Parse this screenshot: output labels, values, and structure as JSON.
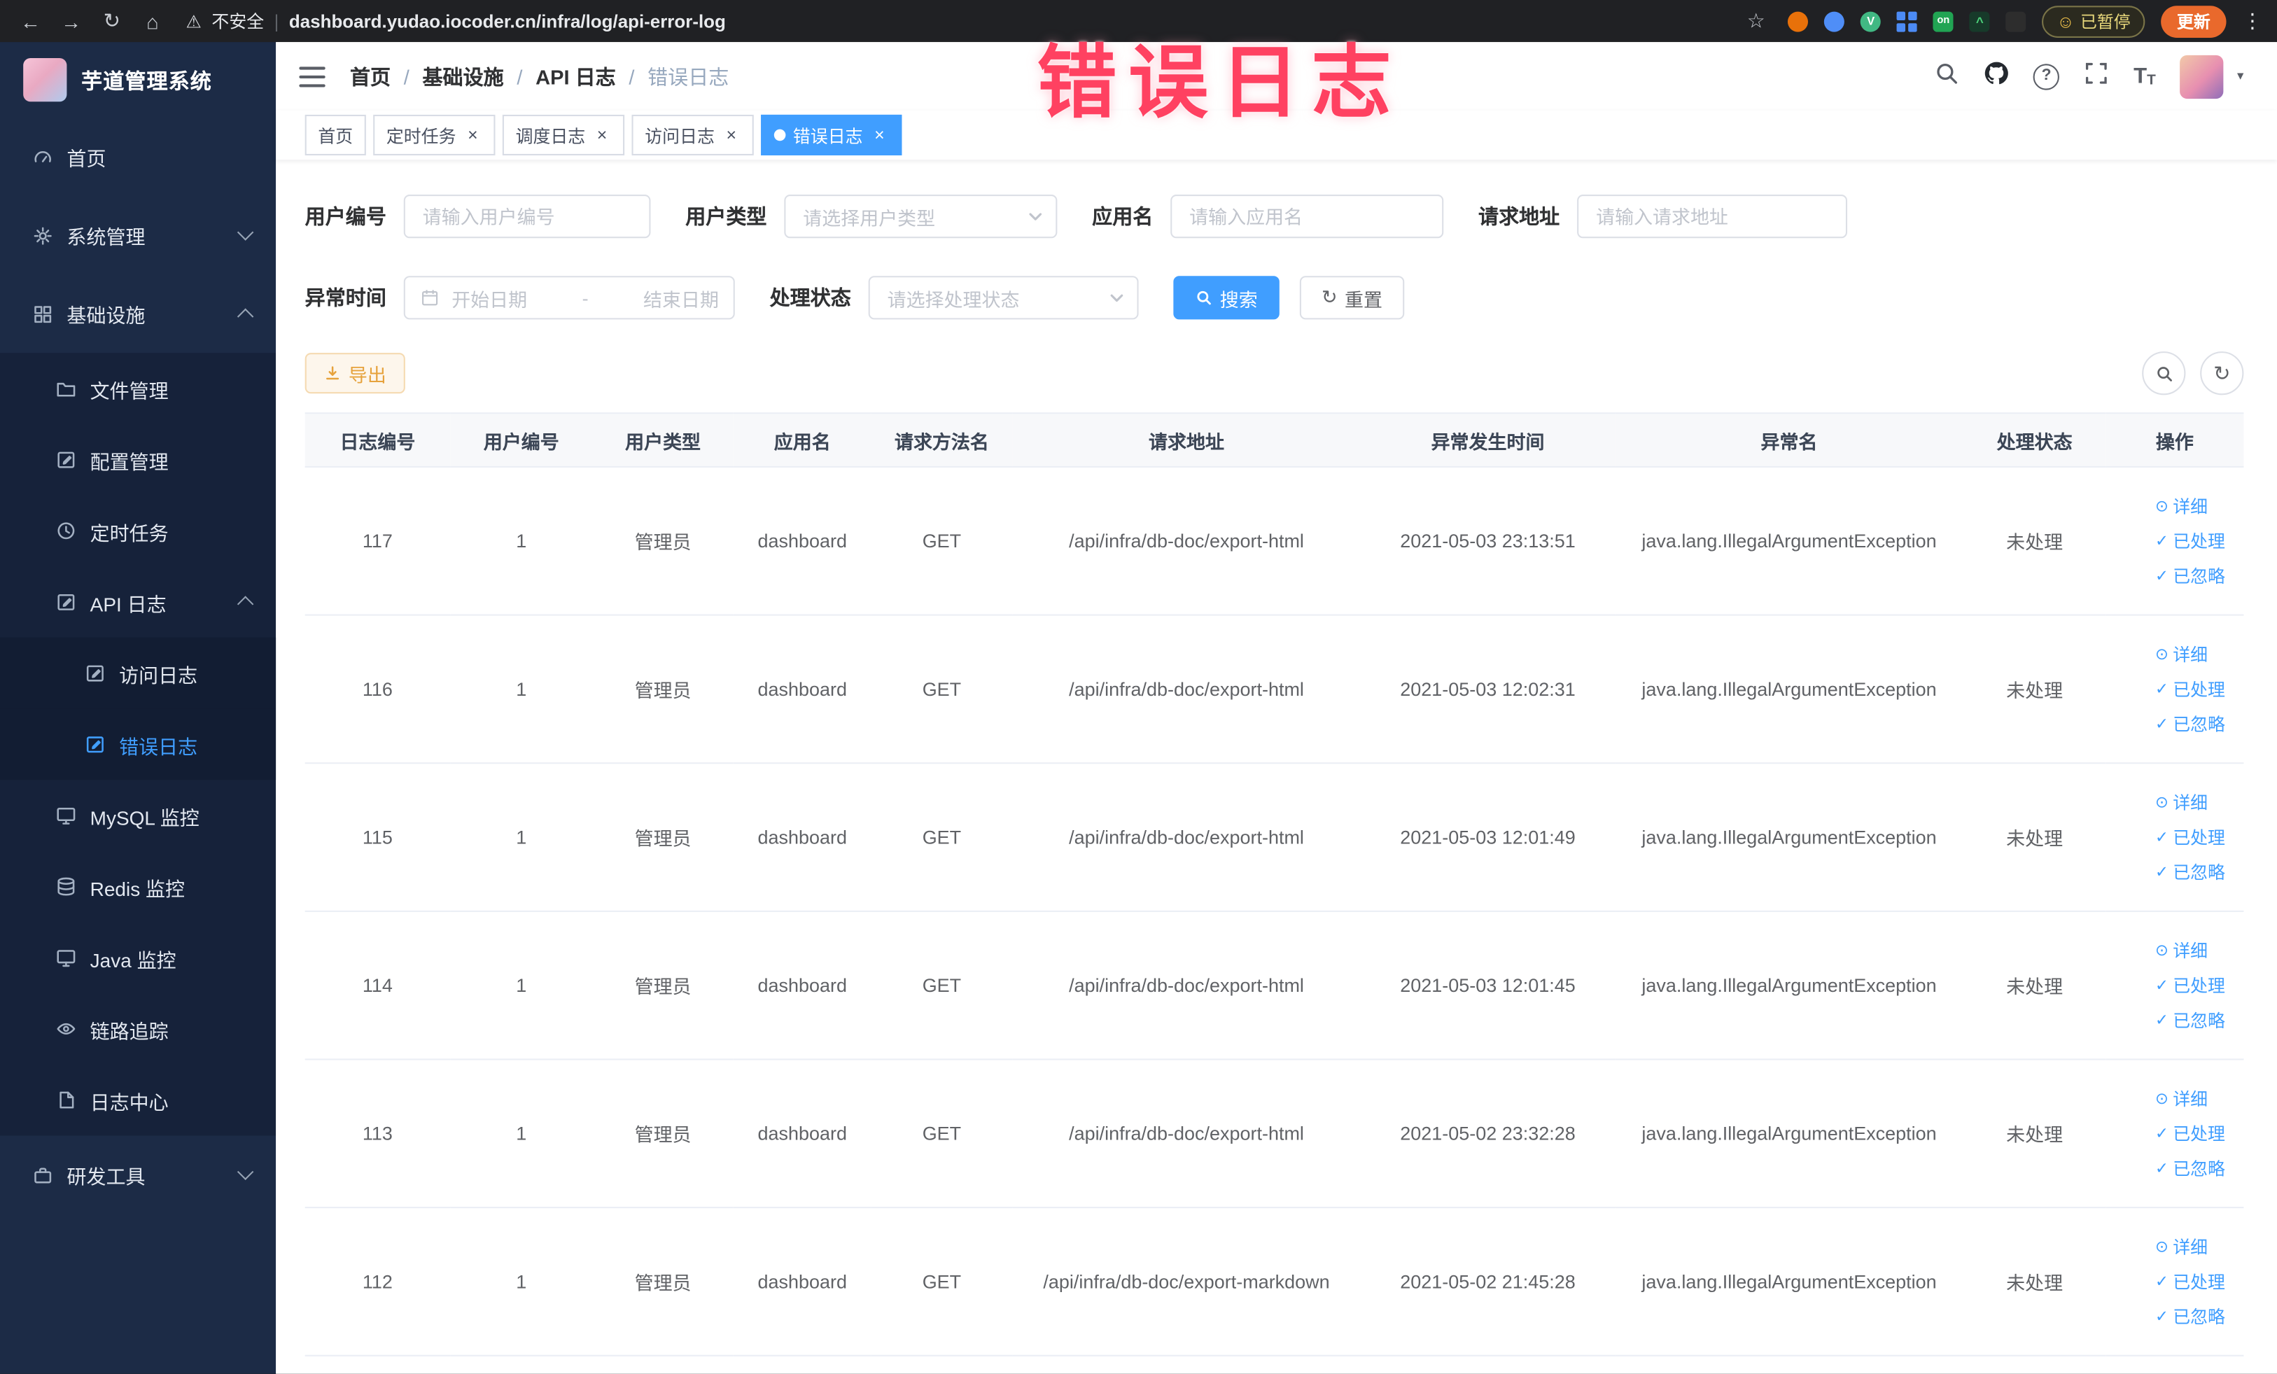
{
  "browser": {
    "security_label": "不安全",
    "url": "dashboard.yudao.iocoder.cn/infra/log/api-error-log",
    "paused_badge": "已暂停",
    "update_button": "更新"
  },
  "icons": {
    "back": "←",
    "forward": "→",
    "reload": "↻",
    "home": "⌂",
    "warning": "⚠",
    "star": "☆",
    "kebab": "⋮",
    "smiley": "☺",
    "question": "?",
    "vue_badge": "V",
    "on_badge": "on",
    "font_big": "T",
    "font_small": "T",
    "caret_down": "▾",
    "check": "✓",
    "eye": "⊙",
    "refresh": "↻",
    "close": "×"
  },
  "overlay": {
    "text": "错误日志"
  },
  "sidebar": {
    "logo_title": "芋道管理系统",
    "menu": [
      {
        "label": "首页"
      },
      {
        "label": "系统管理"
      },
      {
        "label": "基础设施"
      },
      {
        "label": "文件管理"
      },
      {
        "label": "配置管理"
      },
      {
        "label": "定时任务"
      },
      {
        "label": "API 日志"
      },
      {
        "label": "访问日志"
      },
      {
        "label": "错误日志"
      },
      {
        "label": "MySQL 监控"
      },
      {
        "label": "Redis 监控"
      },
      {
        "label": "Java 监控"
      },
      {
        "label": "链路追踪"
      },
      {
        "label": "日志中心"
      },
      {
        "label": "研发工具"
      }
    ]
  },
  "header": {
    "breadcrumb": [
      "首页",
      "基础设施",
      "API 日志",
      "错误日志"
    ]
  },
  "tabs": [
    {
      "label": "首页"
    },
    {
      "label": "定时任务"
    },
    {
      "label": "调度日志"
    },
    {
      "label": "访问日志"
    },
    {
      "label": "错误日志"
    }
  ],
  "filters": {
    "user_id": {
      "label": "用户编号",
      "placeholder": "请输入用户编号"
    },
    "user_type": {
      "label": "用户类型",
      "placeholder": "请选择用户类型"
    },
    "app_name": {
      "label": "应用名",
      "placeholder": "请输入应用名"
    },
    "request_url": {
      "label": "请求地址",
      "placeholder": "请输入请求地址"
    },
    "exception_time": {
      "label": "异常时间",
      "start_placeholder": "开始日期",
      "separator": "-",
      "end_placeholder": "结束日期"
    },
    "process_status": {
      "label": "处理状态",
      "placeholder": "请选择处理状态"
    },
    "search_button": "搜索",
    "reset_button": "重置"
  },
  "toolbar": {
    "export_button": "导出"
  },
  "table": {
    "columns": [
      "日志编号",
      "用户编号",
      "用户类型",
      "应用名",
      "请求方法名",
      "请求地址",
      "异常发生时间",
      "异常名",
      "处理状态",
      "操作"
    ],
    "row_actions": [
      "详细",
      "已处理",
      "已忽略"
    ],
    "rows": [
      {
        "id": "117",
        "user_id": "1",
        "user_type": "管理员",
        "app": "dashboard",
        "method": "GET",
        "url": "/api/infra/db-doc/export-html",
        "time": "2021-05-03 23:13:51",
        "exception": "java.lang.IllegalArgumentException",
        "status": "未处理"
      },
      {
        "id": "116",
        "user_id": "1",
        "user_type": "管理员",
        "app": "dashboard",
        "method": "GET",
        "url": "/api/infra/db-doc/export-html",
        "time": "2021-05-03 12:02:31",
        "exception": "java.lang.IllegalArgumentException",
        "status": "未处理"
      },
      {
        "id": "115",
        "user_id": "1",
        "user_type": "管理员",
        "app": "dashboard",
        "method": "GET",
        "url": "/api/infra/db-doc/export-html",
        "time": "2021-05-03 12:01:49",
        "exception": "java.lang.IllegalArgumentException",
        "status": "未处理"
      },
      {
        "id": "114",
        "user_id": "1",
        "user_type": "管理员",
        "app": "dashboard",
        "method": "GET",
        "url": "/api/infra/db-doc/export-html",
        "time": "2021-05-03 12:01:45",
        "exception": "java.lang.IllegalArgumentException",
        "status": "未处理"
      },
      {
        "id": "113",
        "user_id": "1",
        "user_type": "管理员",
        "app": "dashboard",
        "method": "GET",
        "url": "/api/infra/db-doc/export-html",
        "time": "2021-05-02 23:32:28",
        "exception": "java.lang.IllegalArgumentException",
        "status": "未处理"
      },
      {
        "id": "112",
        "user_id": "1",
        "user_type": "管理员",
        "app": "dashboard",
        "method": "GET",
        "url": "/api/infra/db-doc/export-markdown",
        "time": "2021-05-02 21:45:28",
        "exception": "java.lang.IllegalArgumentException",
        "status": "未处理"
      }
    ]
  },
  "colors": {
    "accent": "#409eff",
    "warning": "#e6a23c",
    "overlay_text": "#ff4161",
    "sidebar_bg": "#1c2b46"
  }
}
